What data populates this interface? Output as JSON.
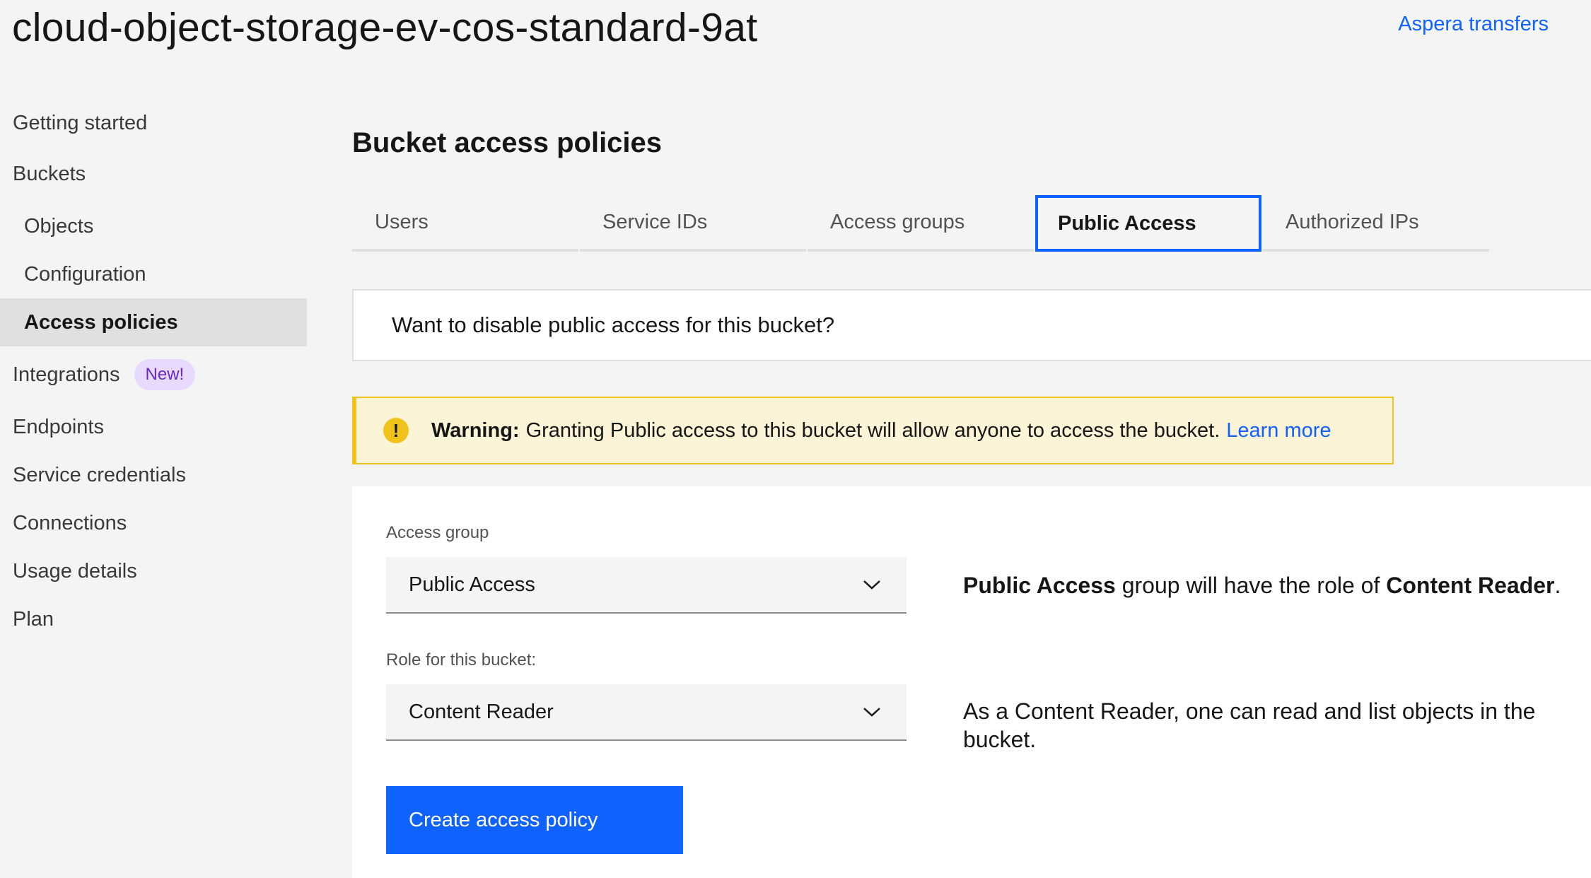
{
  "header": {
    "title": "cloud-object-storage-ev-cos-standard-9at",
    "aspera_link": "Aspera transfers"
  },
  "sidebar": {
    "items": [
      {
        "label": "Getting started"
      },
      {
        "label": "Buckets"
      },
      {
        "label": "Objects"
      },
      {
        "label": "Configuration"
      },
      {
        "label": "Access policies",
        "active": true
      },
      {
        "label": "Integrations",
        "badge": "New!"
      },
      {
        "label": "Endpoints"
      },
      {
        "label": "Service credentials"
      },
      {
        "label": "Connections"
      },
      {
        "label": "Usage details"
      },
      {
        "label": "Plan"
      }
    ]
  },
  "main": {
    "section_title": "Bucket access policies",
    "tabs": [
      {
        "label": "Users"
      },
      {
        "label": "Service IDs"
      },
      {
        "label": "Access groups"
      },
      {
        "label": "Public Access",
        "selected": true
      },
      {
        "label": "Authorized IPs"
      }
    ],
    "disable_prompt": "Want to disable public access for this bucket?",
    "warning": {
      "label": "Warning:",
      "text": "Granting Public access to this bucket will allow anyone to access the bucket.",
      "link": "Learn more",
      "icon": "warning-icon"
    },
    "form": {
      "access_group_label": "Access group",
      "access_group_value": "Public Access",
      "role_label": "Role for this bucket:",
      "role_value": "Content Reader",
      "group_desc_bold1": "Public Access",
      "group_desc_mid": " group will have the role of ",
      "group_desc_bold2": "Content Reader",
      "group_desc_end": ".",
      "role_desc": "As a Content Reader, one can read and list objects in the bucket.",
      "create_button": "Create access policy"
    }
  },
  "colors": {
    "accent": "#0f62fe",
    "warning": "#f1c21b",
    "warning_bg": "#fcf4d6",
    "badge_bg": "#e8daff",
    "badge_text": "#6929c4"
  }
}
